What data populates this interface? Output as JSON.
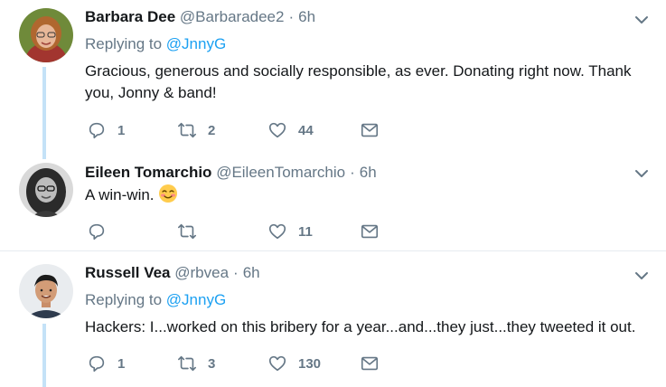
{
  "tweets": [
    {
      "name": "Barbara Dee",
      "handle": "@Barbaradee2",
      "dot": "·",
      "time": "6h",
      "reply_prefix": "Replying to",
      "reply_to": "@JnnyG",
      "text": "Gracious, generous and socially responsible, as ever. Donating right now. Thank you, Jonny & band!",
      "replies": "1",
      "retweets": "2",
      "likes": "44"
    },
    {
      "name": "Eileen Tomarchio",
      "handle": "@EileenTomarchio",
      "dot": "·",
      "time": "6h",
      "text": "A win-win.",
      "emoji": "smiling-face-with-smiling-eyes",
      "replies": "",
      "retweets": "",
      "likes": "11"
    },
    {
      "name": "Russell Vea",
      "handle": "@rbvea",
      "dot": "·",
      "time": "6h",
      "reply_prefix": "Replying to",
      "reply_to": "@JnnyG",
      "text": "Hackers: I...worked on this bribery for a year...and...they just...they tweeted it out.",
      "replies": "1",
      "retweets": "3",
      "likes": "130"
    }
  ],
  "icons": {
    "reply": "reply-icon",
    "retweet": "retweet-icon",
    "like": "heart-icon",
    "dm": "envelope-icon",
    "caret": "chevron-down-icon"
  },
  "colors": {
    "link": "#1da1f2",
    "muted": "#657786",
    "thread_line": "#c4e2f7",
    "divider": "#e6ecf0"
  }
}
